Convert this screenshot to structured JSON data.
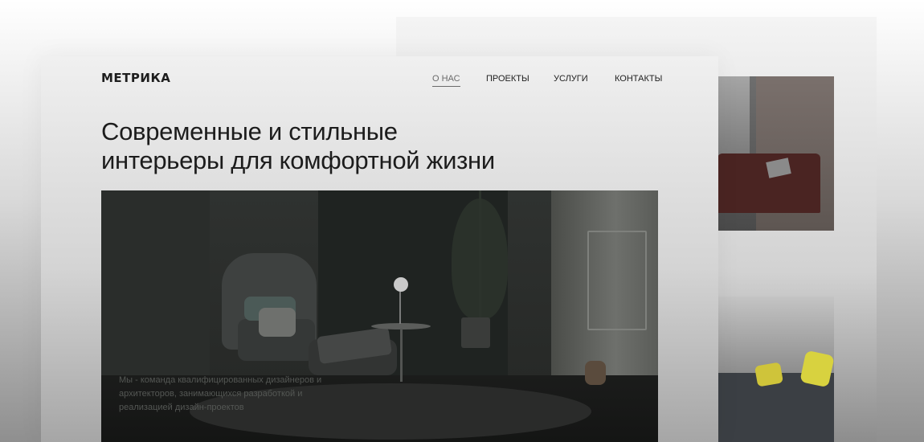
{
  "brand": {
    "logo_text": "МЕТРИКА"
  },
  "nav": {
    "items": [
      {
        "label": "О НАС",
        "active": true
      },
      {
        "label": "ПРОЕКТЫ",
        "active": false
      },
      {
        "label": "УСЛУГИ",
        "active": false
      },
      {
        "label": "КОНТАКТЫ",
        "active": false
      }
    ]
  },
  "hero": {
    "headline_line1": "Современные и стильные",
    "headline_line2": "интерьеры для комфортной жизни",
    "caption": "Мы - команда квалифицированных дизайнеров и архитекторов, занимающихся разработкой и реализацией дизайн-проектов"
  },
  "colors": {
    "text_primary": "#1c1c1c",
    "nav_active": "#6b6b6b",
    "accent_sofa": "#4a2422",
    "accent_pillow": "#d8d23f"
  }
}
